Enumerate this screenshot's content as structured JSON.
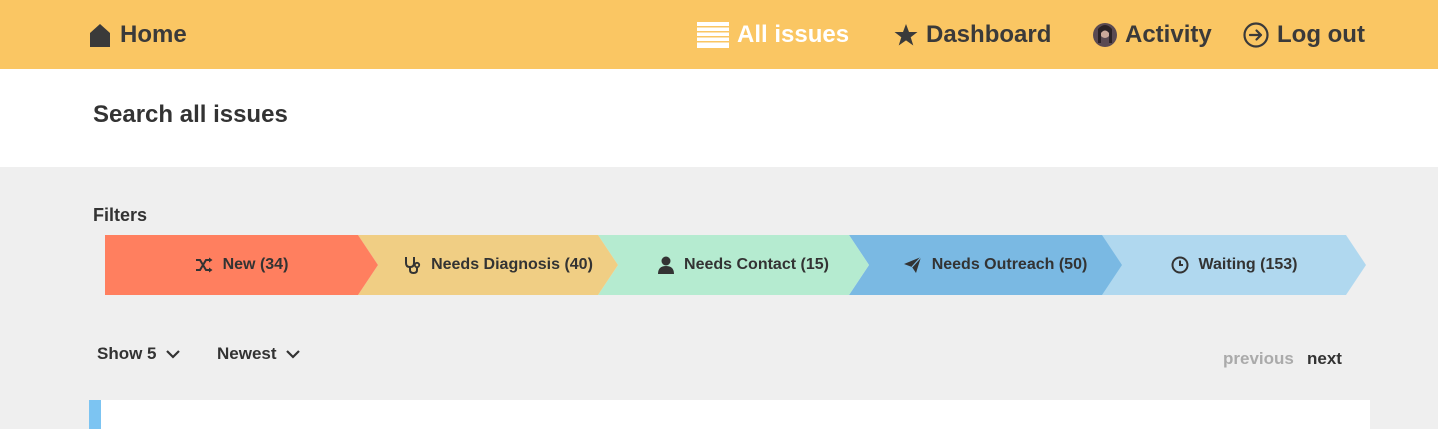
{
  "header": {
    "home_label": "Home",
    "all_issues_label": "All issues",
    "dashboard_label": "Dashboard",
    "activity_label": "Activity",
    "logout_label": "Log out",
    "background": "#fac663"
  },
  "search": {
    "title": "Search all issues"
  },
  "filters": {
    "label": "Filters",
    "items": [
      {
        "label": "New (34)",
        "icon": "shuffle-icon",
        "color": "#ff7f5f"
      },
      {
        "label": "Needs Diagnosis (40)",
        "icon": "stethoscope-icon",
        "color": "#f0ce84"
      },
      {
        "label": "Needs Contact (15)",
        "icon": "user-icon",
        "color": "#b5ebd0"
      },
      {
        "label": "Needs Outreach (50)",
        "icon": "paper-plane-icon",
        "color": "#7ab9e3"
      },
      {
        "label": "Waiting (153)",
        "icon": "clock-icon",
        "color": "#b0d8ef"
      }
    ]
  },
  "controls": {
    "show_label": "Show 5",
    "sort_label": "Newest",
    "previous_label": "previous",
    "next_label": "next"
  }
}
